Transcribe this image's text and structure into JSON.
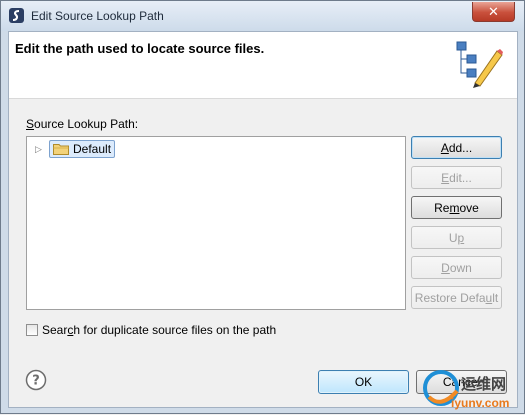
{
  "window": {
    "title": "Edit Source Lookup Path",
    "close_glyph": "✕"
  },
  "header": {
    "message": "Edit the path used to locate source files.",
    "icon": "source-path-edit-icon"
  },
  "section": {
    "label_pre": "",
    "label_mnemonic": "S",
    "label_post": "ource Lookup Path:"
  },
  "tree": {
    "items": [
      {
        "label": "Default",
        "icon": "folder-icon",
        "expanded": false,
        "selected": true
      }
    ]
  },
  "side_buttons": {
    "add": {
      "pre": "",
      "mn": "A",
      "post": "dd..."
    },
    "edit": {
      "pre": "",
      "mn": "E",
      "post": "dit..."
    },
    "remove": {
      "pre": "Re",
      "mn": "m",
      "post": "ove"
    },
    "up": {
      "pre": "U",
      "mn": "p",
      "post": ""
    },
    "down": {
      "pre": "",
      "mn": "D",
      "post": "own"
    },
    "restore": {
      "pre": "Restore Defa",
      "mn": "u",
      "post": "lt"
    }
  },
  "checkbox": {
    "pre": "Sear",
    "mn": "c",
    "post": "h for duplicate source files on the path",
    "checked": false
  },
  "footer": {
    "ok_label": "OK",
    "cancel_label": "Cancel"
  },
  "watermark": {
    "line1": "运维网",
    "line2": "iyunv.com"
  },
  "colors": {
    "title_bar": "#cddbea",
    "selection": "#dcebfc",
    "default_button_border": "#3c7fb1"
  }
}
